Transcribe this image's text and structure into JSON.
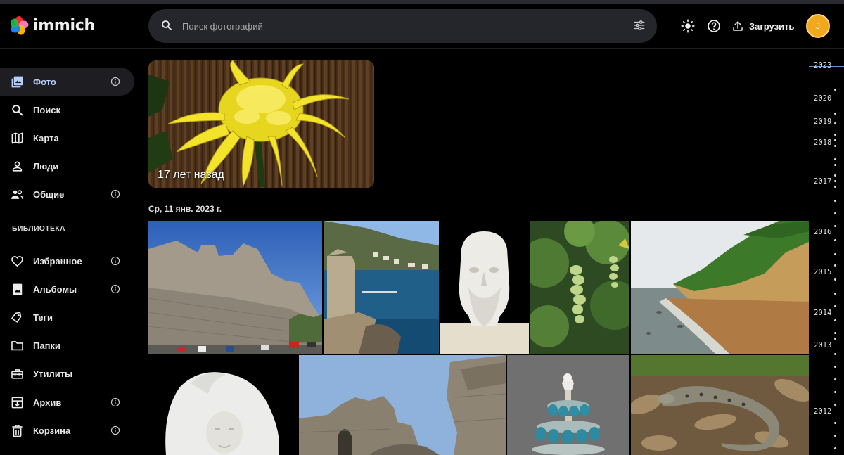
{
  "app": {
    "name": "immich"
  },
  "search": {
    "placeholder": "Поиск фотографий"
  },
  "header": {
    "upload_label": "Загрузить",
    "avatar_initial": "J"
  },
  "sidebar": {
    "items": [
      {
        "id": "photos",
        "label": "Фото",
        "icon": "photos-icon",
        "info": true,
        "active": true
      },
      {
        "id": "search",
        "label": "Поиск",
        "icon": "search-icon",
        "info": false
      },
      {
        "id": "map",
        "label": "Карта",
        "icon": "map-icon",
        "info": false
      },
      {
        "id": "people",
        "label": "Люди",
        "icon": "person-icon",
        "info": false
      },
      {
        "id": "shared",
        "label": "Общие",
        "icon": "people-icon",
        "info": true
      }
    ],
    "library_title": "БИБЛИОТЕКА",
    "library": [
      {
        "id": "favorites",
        "label": "Избранное",
        "icon": "heart-icon",
        "info": true
      },
      {
        "id": "albums",
        "label": "Альбомы",
        "icon": "album-icon",
        "info": true
      },
      {
        "id": "tags",
        "label": "Теги",
        "icon": "tag-icon",
        "info": false
      },
      {
        "id": "folders",
        "label": "Папки",
        "icon": "folder-icon",
        "info": false
      },
      {
        "id": "utilities",
        "label": "Утилиты",
        "icon": "toolbox-icon",
        "info": false
      },
      {
        "id": "archive",
        "label": "Архив",
        "icon": "archive-icon",
        "info": true
      },
      {
        "id": "trash",
        "label": "Корзина",
        "icon": "trash-icon",
        "info": true
      }
    ]
  },
  "memory": {
    "label": "17 лет назад"
  },
  "date_group": {
    "title": "Ср, 11 янв. 2023 г."
  },
  "timeline": {
    "years": [
      "2023",
      "2020",
      "2019",
      "2018",
      "2017",
      "2016",
      "2015",
      "2014",
      "2013",
      "2012"
    ]
  },
  "colors": {
    "accent": "#b8cffc",
    "avatar": "#f0a81d",
    "search_bg": "#25262b"
  }
}
